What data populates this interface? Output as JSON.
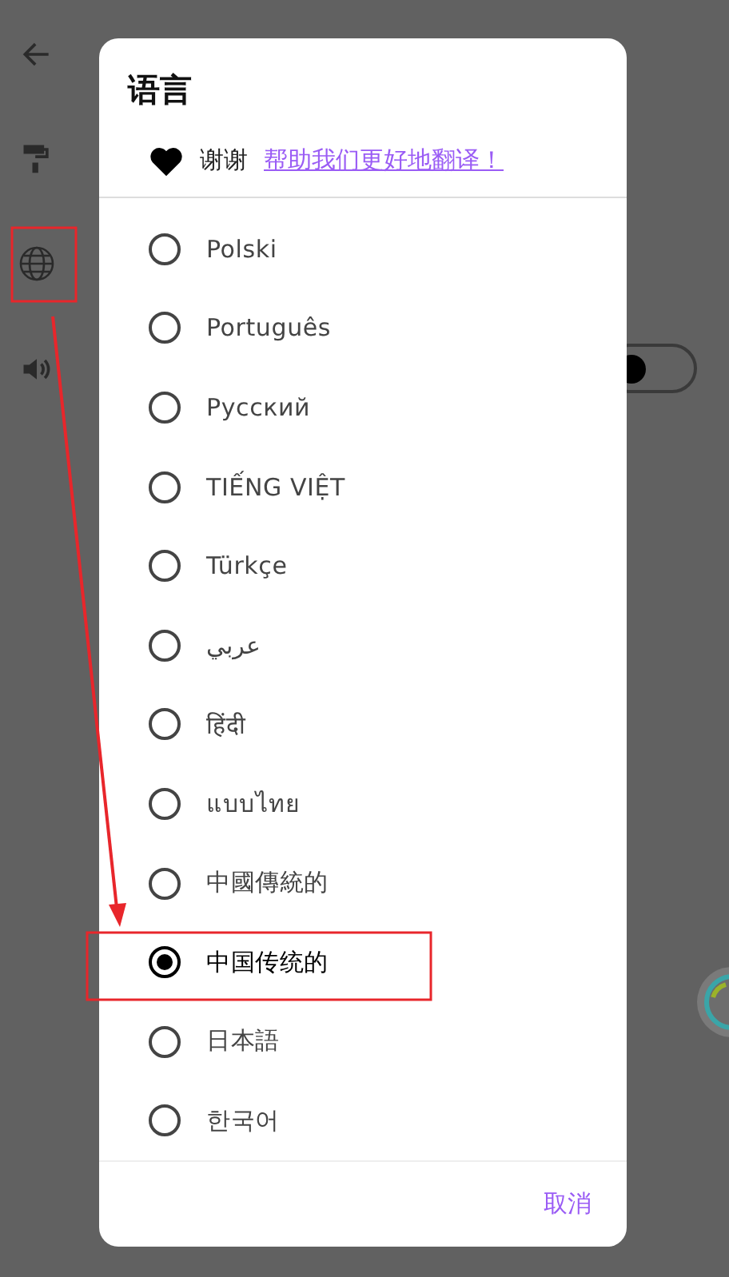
{
  "background": {
    "switch": {
      "on": false
    }
  },
  "dialog": {
    "title": "语言",
    "thanks": {
      "text": "谢谢",
      "link": "帮助我们更好地翻译！"
    },
    "options": [
      {
        "label": "Polski",
        "selected": false
      },
      {
        "label": "Português",
        "selected": false
      },
      {
        "label": "Русский",
        "selected": false
      },
      {
        "label": "TIẾNG VIỆT",
        "selected": false
      },
      {
        "label": "Türkçe",
        "selected": false
      },
      {
        "label": "عربي",
        "selected": false
      },
      {
        "label": "हिंदी",
        "selected": false
      },
      {
        "label": "แบบไทย",
        "selected": false
      },
      {
        "label": "中國傳統的",
        "selected": false
      },
      {
        "label": "中国传统的",
        "selected": true
      },
      {
        "label": "日本語",
        "selected": false
      },
      {
        "label": "한국어",
        "selected": false
      }
    ],
    "cancel": "取消"
  }
}
